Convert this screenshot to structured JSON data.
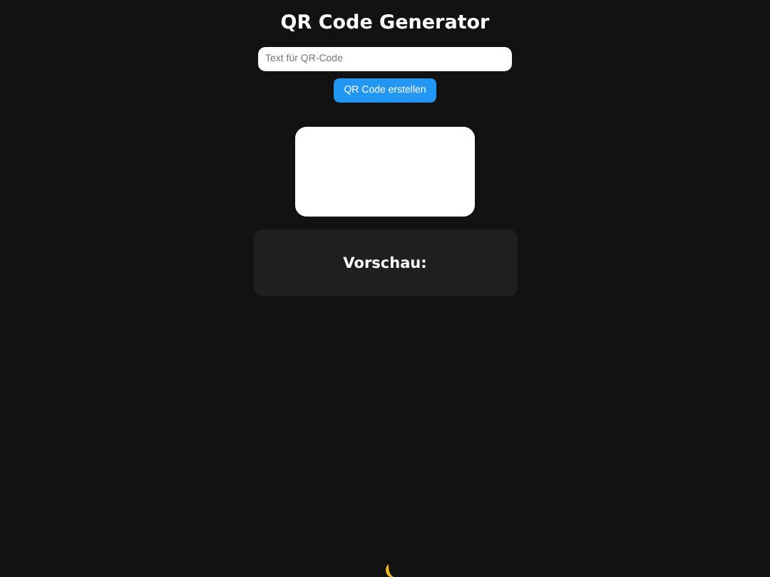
{
  "title": "QR Code Generator",
  "input": {
    "placeholder": "Text für QR-Code"
  },
  "button": {
    "label": "QR Code erstellen"
  },
  "preview": {
    "heading": "Vorschau:"
  }
}
